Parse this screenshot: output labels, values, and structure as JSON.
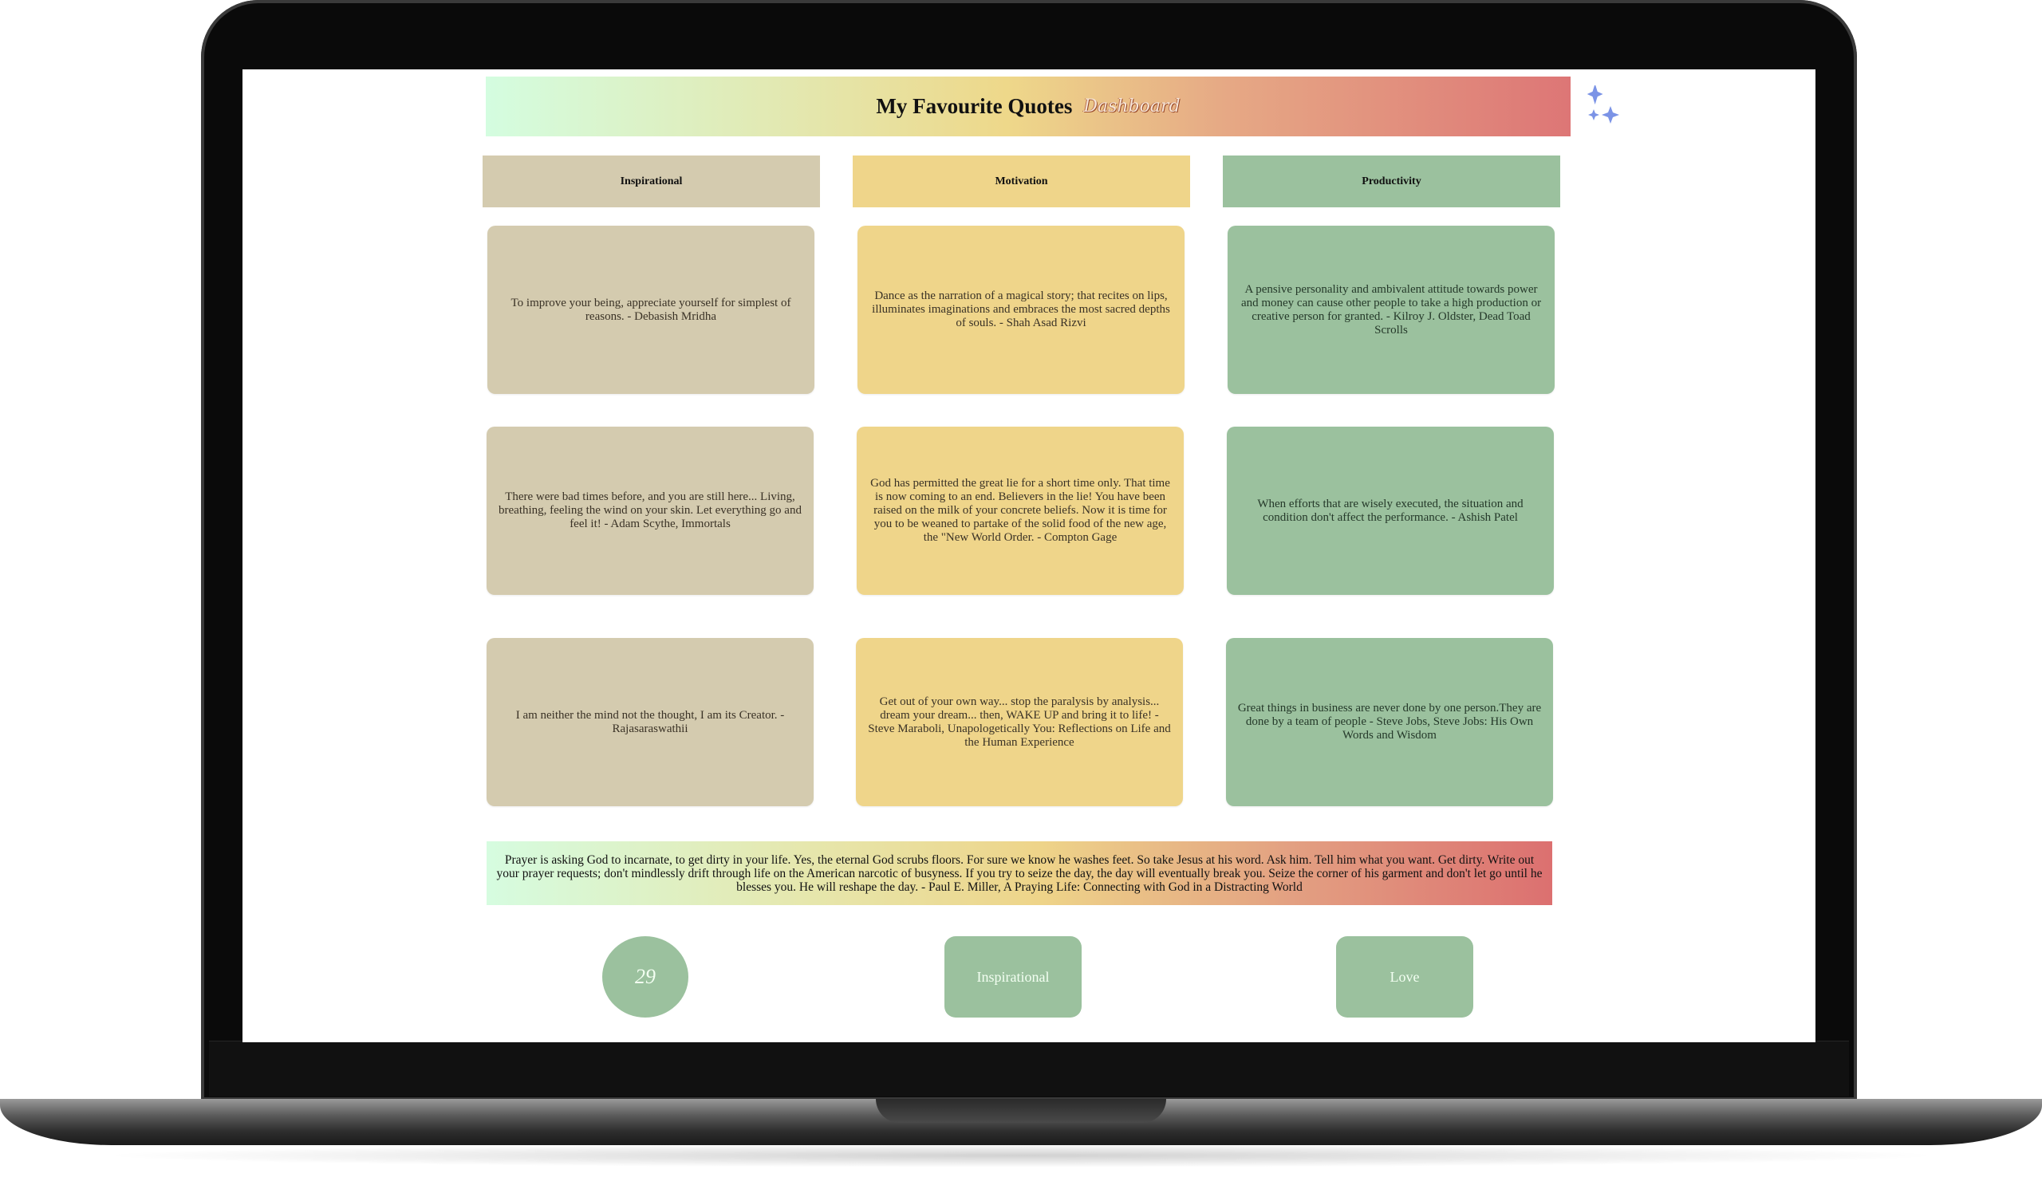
{
  "header": {
    "title": "My Favourite Quotes",
    "subtitle": "Dashboard",
    "icon": "sparkle-icon"
  },
  "categories": [
    {
      "label": "Inspirational",
      "color": "#d4cbaf"
    },
    {
      "label": "Motivation",
      "color": "#efd58a"
    },
    {
      "label": "Productivity",
      "color": "#9bc19e"
    }
  ],
  "quotes": {
    "inspirational": [
      "To improve your being, appreciate yourself for simplest of reasons. - Debasish Mridha",
      "There were bad times before, and you are still here... Living, breathing, feeling the wind on your skin. Let everything go and feel it! - Adam Scythe, Immortals",
      "I am neither the mind not the thought, I am its Creator. - Rajasaraswathii"
    ],
    "motivation": [
      "Dance as the narration of a magical story; that recites on lips, illuminates imaginations and embraces the most sacred depths of souls. - Shah Asad Rizvi",
      "God has permitted the great lie for a short time only. That time is now coming to an end. Believers in the lie! You have been raised on the milk of your concrete beliefs. Now it is time for you to be weaned to partake of the solid food of the new age, the \"New World Order. - Compton Gage",
      "Get out of your own way... stop the paralysis by analysis... dream your dream... then, WAKE UP and bring it to life! - Steve Maraboli, Unapologetically You: Reflections on Life and the Human Experience"
    ],
    "productivity": [
      "A pensive personality and ambivalent attitude towards power and money can cause other people to take a high production or creative person for granted. - Kilroy J. Oldster, Dead Toad Scrolls",
      "When efforts that are wisely executed, the situation and condition don't affect the performance. - Ashish Patel",
      "Great things in business are never done by one person.They are done by a team of people - Steve Jobs, Steve Jobs: His Own Words and Wisdom"
    ]
  },
  "featured_quote": "Prayer is asking God to incarnate, to get dirty in your life. Yes, the eternal God scrubs floors. For sure we know he washes feet. So take Jesus at his word. Ask him. Tell him what you want. Get dirty. Write out your prayer requests; don't mindlessly drift through life on the American narcotic of busyness. If you try to seize the day, the day will eventually break you. Seize the corner of his garment and don't let go until he blesses you. He will reshape the day. - Paul E. Miller, A Praying Life: Connecting with God in a Distracting World",
  "footer": {
    "count": "29",
    "tag_1": "Inspirational",
    "tag_2": "Love"
  }
}
